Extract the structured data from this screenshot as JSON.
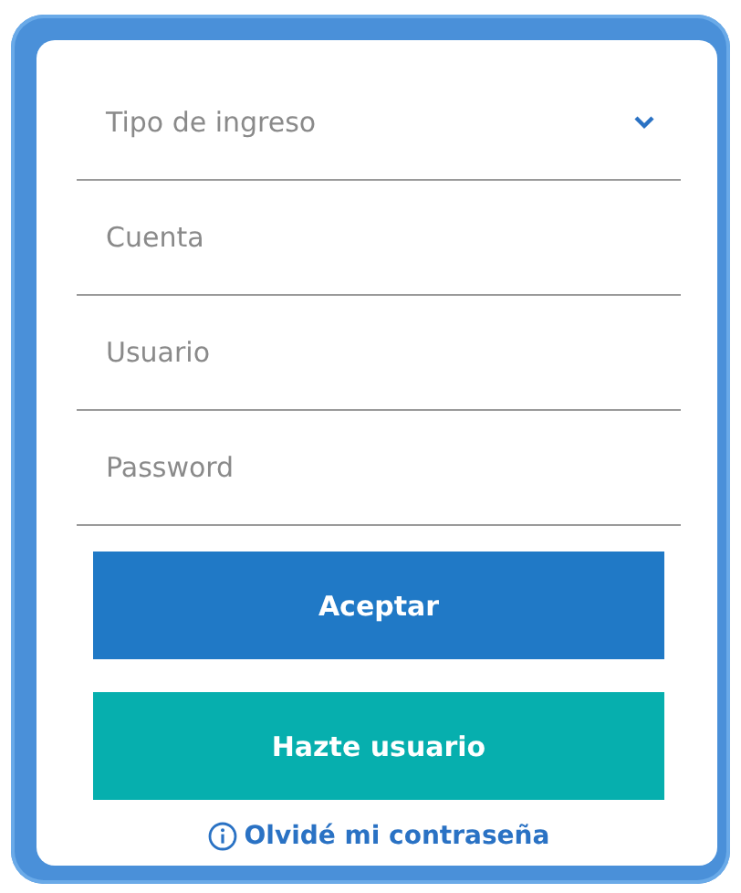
{
  "login_form": {
    "fields": [
      {
        "kind": "select",
        "placeholder": "Tipo de ingreso"
      },
      {
        "kind": "text",
        "placeholder": "Cuenta"
      },
      {
        "kind": "text",
        "placeholder": "Usuario"
      },
      {
        "kind": "password",
        "placeholder": "Password"
      }
    ],
    "buttons": [
      {
        "kind": "primary",
        "label": "Aceptar"
      },
      {
        "kind": "secondary",
        "label": "Hazte usuario"
      }
    ],
    "forgot_link": "Olvidé mi contraseña"
  }
}
